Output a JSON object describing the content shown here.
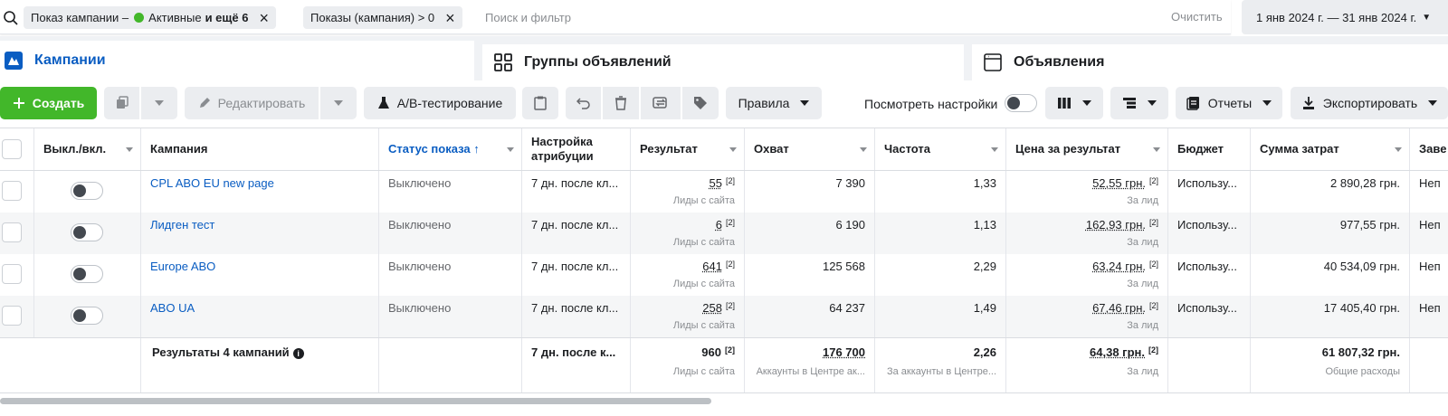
{
  "filters": {
    "chip1": {
      "label": "Показ кампании –",
      "value": "Активные",
      "more": "и ещё 6"
    },
    "chip2": {
      "label": "Показы (кампания) > 0"
    },
    "search_placeholder": "Поиск и фильтр",
    "clear": "Очистить",
    "date_range": "1 янв 2024 г. — 31 янв 2024 г."
  },
  "tabs": [
    {
      "label": "Кампании",
      "icon": "campaigns-icon"
    },
    {
      "label": "Группы объявлений",
      "icon": "grid-icon"
    },
    {
      "label": "Объявления",
      "icon": "ad-icon"
    }
  ],
  "toolbar": {
    "create": "Создать",
    "edit": "Редактировать",
    "ab_test": "A/B-тестирование",
    "rules": "Правила",
    "view_settings": "Посмотреть настройки",
    "reports": "Отчеты",
    "export": "Экспортировать"
  },
  "columns": [
    "Выкл./вкл.",
    "Кампания",
    "Статус показа ↑",
    "Настройка атрибуции",
    "Результат",
    "Охват",
    "Частота",
    "Цена за результат",
    "Бюджет",
    "Сумма затрат",
    "Заве"
  ],
  "rows": [
    {
      "campaign": "CPL ABO EU new page",
      "status": "Выключено",
      "attribution": "7 дн. после кл...",
      "result": "55",
      "result_sub": "Лиды с сайта",
      "reach": "7 390",
      "frequency": "1,33",
      "cpr": "52,55 грн.",
      "cpr_sub": "За лид",
      "budget": "Использу...",
      "spend": "2 890,28 грн.",
      "ends": "Неп"
    },
    {
      "campaign": "Лидген тест",
      "status": "Выключено",
      "attribution": "7 дн. после кл...",
      "result": "6",
      "result_sub": "Лиды с сайта",
      "reach": "6 190",
      "frequency": "1,13",
      "cpr": "162,93 грн.",
      "cpr_sub": "За лид",
      "budget": "Использу...",
      "spend": "977,55 грн.",
      "ends": "Неп"
    },
    {
      "campaign": "Europe ABO",
      "status": "Выключено",
      "attribution": "7 дн. после кл...",
      "result": "641",
      "result_sub": "Лиды с сайта",
      "reach": "125 568",
      "frequency": "2,29",
      "cpr": "63,24 грн.",
      "cpr_sub": "За лид",
      "budget": "Использу...",
      "spend": "40 534,09 грн.",
      "ends": "Неп"
    },
    {
      "campaign": "ABO UA",
      "status": "Выключено",
      "attribution": "7 дн. после кл...",
      "result": "258",
      "result_sub": "Лиды с сайта",
      "reach": "64 237",
      "frequency": "1,49",
      "cpr": "67,46 грн.",
      "cpr_sub": "За лид",
      "budget": "Использу...",
      "spend": "17 405,40 грн.",
      "ends": "Неп"
    }
  ],
  "totals": {
    "label": "Результаты 4 кампаний",
    "attribution": "7 дн. после к...",
    "result": "960",
    "result_sub": "Лиды с сайта",
    "reach": "176 700",
    "reach_sub": "Аккаунты в Центре ак...",
    "frequency": "2,26",
    "frequency_sub": "За аккаунты в Центре...",
    "cpr": "64,38 грн.",
    "cpr_sub": "За лид",
    "spend": "61 807,32 грн.",
    "spend_sub": "Общие расходы"
  },
  "footnote_mark": "[2]"
}
